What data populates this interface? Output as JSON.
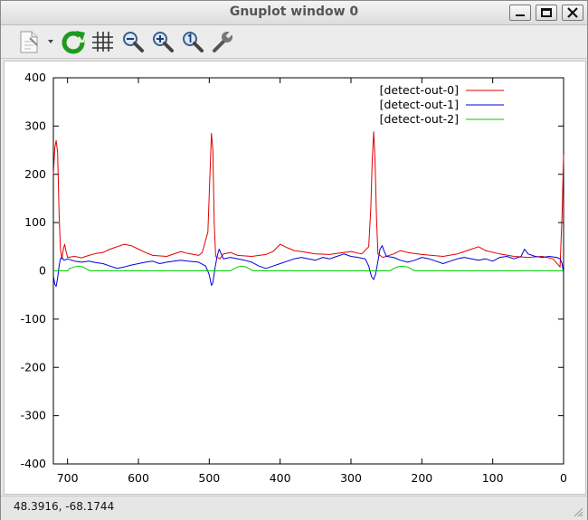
{
  "window": {
    "title": "Gnuplot window 0",
    "controls": [
      "minimize",
      "maximize",
      "close"
    ]
  },
  "toolbar": {
    "tools": [
      {
        "name": "export-icon",
        "label": "Export"
      },
      {
        "name": "replot-icon",
        "label": "Replot"
      },
      {
        "name": "grid-icon",
        "label": "Grid"
      },
      {
        "name": "zoom-out-icon",
        "label": "Zoom out"
      },
      {
        "name": "zoom-in-icon",
        "label": "Zoom in"
      },
      {
        "name": "zoom-reset-icon",
        "label": "Zoom 1"
      },
      {
        "name": "config-wrench-icon",
        "label": "Configuration"
      }
    ]
  },
  "status": {
    "coordinates": "48.3916, -68.1744"
  },
  "colors": {
    "series0": "#e00000",
    "series1": "#0000dd",
    "series2": "#00cc00"
  },
  "chart_data": {
    "type": "line",
    "title": "",
    "xlabel": "",
    "ylabel": "",
    "xlim": [
      720,
      0
    ],
    "ylim": [
      -400,
      400
    ],
    "x_reversed": true,
    "xticks": [
      700,
      600,
      500,
      400,
      300,
      200,
      100,
      0
    ],
    "yticks": [
      400,
      300,
      200,
      100,
      0,
      -100,
      -200,
      -300,
      -400
    ],
    "legend_position": "top-right",
    "grid": false,
    "series": [
      {
        "name": "[detect-out-0]",
        "color": "#e00000",
        "points": [
          [
            720,
            200
          ],
          [
            718,
            255
          ],
          [
            716,
            270
          ],
          [
            714,
            245
          ],
          [
            712,
            120
          ],
          [
            710,
            45
          ],
          [
            708,
            25
          ],
          [
            706,
            45
          ],
          [
            704,
            55
          ],
          [
            702,
            40
          ],
          [
            700,
            28
          ],
          [
            690,
            30
          ],
          [
            680,
            27
          ],
          [
            670,
            32
          ],
          [
            660,
            36
          ],
          [
            650,
            38
          ],
          [
            640,
            45
          ],
          [
            630,
            50
          ],
          [
            620,
            55
          ],
          [
            610,
            52
          ],
          [
            600,
            45
          ],
          [
            590,
            38
          ],
          [
            580,
            32
          ],
          [
            560,
            30
          ],
          [
            540,
            40
          ],
          [
            530,
            36
          ],
          [
            515,
            32
          ],
          [
            510,
            38
          ],
          [
            502,
            80
          ],
          [
            499,
            200
          ],
          [
            497,
            285
          ],
          [
            495,
            250
          ],
          [
            493,
            100
          ],
          [
            491,
            30
          ],
          [
            485,
            25
          ],
          [
            480,
            35
          ],
          [
            470,
            38
          ],
          [
            460,
            32
          ],
          [
            440,
            30
          ],
          [
            420,
            34
          ],
          [
            410,
            40
          ],
          [
            400,
            55
          ],
          [
            390,
            48
          ],
          [
            380,
            42
          ],
          [
            370,
            40
          ],
          [
            350,
            35
          ],
          [
            330,
            34
          ],
          [
            320,
            36
          ],
          [
            300,
            40
          ],
          [
            285,
            35
          ],
          [
            275,
            50
          ],
          [
            272,
            130
          ],
          [
            270,
            230
          ],
          [
            268,
            288
          ],
          [
            266,
            230
          ],
          [
            264,
            110
          ],
          [
            262,
            35
          ],
          [
            255,
            28
          ],
          [
            240,
            35
          ],
          [
            230,
            42
          ],
          [
            220,
            38
          ],
          [
            200,
            34
          ],
          [
            170,
            30
          ],
          [
            150,
            35
          ],
          [
            130,
            45
          ],
          [
            120,
            50
          ],
          [
            110,
            42
          ],
          [
            90,
            35
          ],
          [
            70,
            30
          ],
          [
            50,
            28
          ],
          [
            30,
            30
          ],
          [
            15,
            25
          ],
          [
            5,
            8
          ],
          [
            2,
            120
          ],
          [
            0,
            240
          ]
        ]
      },
      {
        "name": "[detect-out-1]",
        "color": "#0000dd",
        "points": [
          [
            720,
            -10
          ],
          [
            718,
            -28
          ],
          [
            716,
            -32
          ],
          [
            714,
            -15
          ],
          [
            712,
            10
          ],
          [
            710,
            25
          ],
          [
            708,
            28
          ],
          [
            705,
            22
          ],
          [
            700,
            25
          ],
          [
            690,
            20
          ],
          [
            680,
            18
          ],
          [
            670,
            20
          ],
          [
            660,
            17
          ],
          [
            650,
            15
          ],
          [
            640,
            10
          ],
          [
            630,
            5
          ],
          [
            620,
            8
          ],
          [
            610,
            12
          ],
          [
            600,
            15
          ],
          [
            590,
            18
          ],
          [
            580,
            20
          ],
          [
            570,
            15
          ],
          [
            560,
            18
          ],
          [
            550,
            20
          ],
          [
            540,
            22
          ],
          [
            530,
            20
          ],
          [
            515,
            18
          ],
          [
            505,
            10
          ],
          [
            500,
            -8
          ],
          [
            497,
            -30
          ],
          [
            495,
            -25
          ],
          [
            492,
            5
          ],
          [
            489,
            30
          ],
          [
            486,
            45
          ],
          [
            484,
            38
          ],
          [
            480,
            25
          ],
          [
            470,
            28
          ],
          [
            460,
            25
          ],
          [
            450,
            22
          ],
          [
            440,
            18
          ],
          [
            430,
            10
          ],
          [
            420,
            5
          ],
          [
            410,
            10
          ],
          [
            400,
            15
          ],
          [
            390,
            20
          ],
          [
            380,
            25
          ],
          [
            370,
            28
          ],
          [
            360,
            25
          ],
          [
            350,
            22
          ],
          [
            340,
            28
          ],
          [
            330,
            25
          ],
          [
            320,
            30
          ],
          [
            310,
            35
          ],
          [
            300,
            30
          ],
          [
            290,
            28
          ],
          [
            280,
            25
          ],
          [
            275,
            10
          ],
          [
            271,
            -12
          ],
          [
            268,
            -18
          ],
          [
            265,
            -5
          ],
          [
            262,
            20
          ],
          [
            259,
            45
          ],
          [
            256,
            52
          ],
          [
            253,
            40
          ],
          [
            250,
            30
          ],
          [
            240,
            28
          ],
          [
            230,
            22
          ],
          [
            220,
            18
          ],
          [
            210,
            22
          ],
          [
            200,
            28
          ],
          [
            190,
            25
          ],
          [
            180,
            20
          ],
          [
            170,
            15
          ],
          [
            160,
            20
          ],
          [
            150,
            25
          ],
          [
            140,
            28
          ],
          [
            130,
            25
          ],
          [
            120,
            22
          ],
          [
            110,
            25
          ],
          [
            100,
            20
          ],
          [
            90,
            28
          ],
          [
            80,
            30
          ],
          [
            70,
            25
          ],
          [
            60,
            30
          ],
          [
            55,
            45
          ],
          [
            50,
            35
          ],
          [
            40,
            30
          ],
          [
            30,
            28
          ],
          [
            20,
            30
          ],
          [
            10,
            28
          ],
          [
            5,
            25
          ],
          [
            2,
            15
          ],
          [
            0,
            -5
          ]
        ]
      },
      {
        "name": "[detect-out-2]",
        "color": "#00cc00",
        "points": [
          [
            720,
            0
          ],
          [
            700,
            0
          ],
          [
            697,
            5
          ],
          [
            690,
            8
          ],
          [
            685,
            10
          ],
          [
            678,
            8
          ],
          [
            672,
            3
          ],
          [
            668,
            0
          ],
          [
            470,
            0
          ],
          [
            466,
            4
          ],
          [
            460,
            8
          ],
          [
            455,
            10
          ],
          [
            448,
            8
          ],
          [
            442,
            3
          ],
          [
            438,
            0
          ],
          [
            245,
            0
          ],
          [
            241,
            4
          ],
          [
            235,
            8
          ],
          [
            228,
            10
          ],
          [
            220,
            8
          ],
          [
            214,
            3
          ],
          [
            210,
            0
          ],
          [
            0,
            0
          ]
        ]
      }
    ]
  }
}
